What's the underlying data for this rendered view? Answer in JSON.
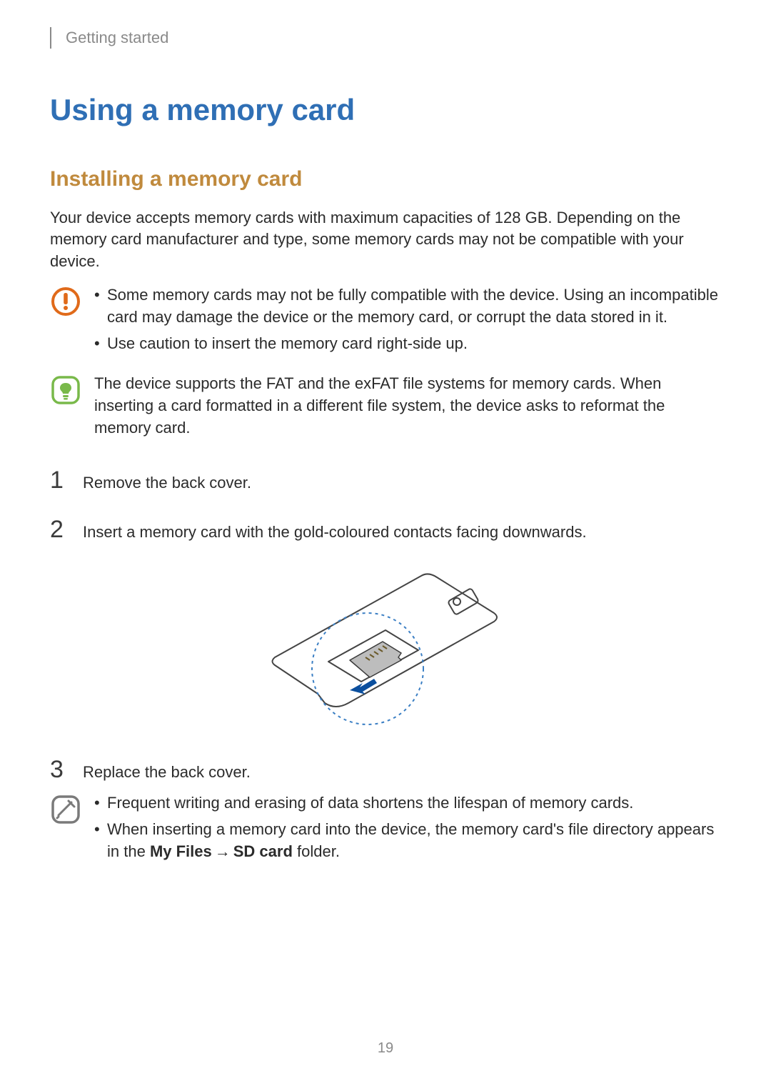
{
  "header": {
    "breadcrumb": "Getting started"
  },
  "title": "Using a memory card",
  "sections": {
    "install": {
      "heading": "Installing a memory card",
      "intro": "Your device accepts memory cards with maximum capacities of 128 GB. Depending on the memory card manufacturer and type, some memory cards may not be compatible with your device.",
      "caution": {
        "items": [
          "Some memory cards may not be fully compatible with the device. Using an incompatible card may damage the device or the memory card, or corrupt the data stored in it.",
          "Use caution to insert the memory card right-side up."
        ]
      },
      "info": {
        "text": "The device supports the FAT and the exFAT file systems for memory cards. When inserting a card formatted in a different file system, the device asks to reformat the memory card."
      },
      "steps": [
        {
          "n": "1",
          "text": "Remove the back cover."
        },
        {
          "n": "2",
          "text": "Insert a memory card with the gold-coloured contacts facing downwards."
        },
        {
          "n": "3",
          "text": "Replace the back cover."
        }
      ],
      "tips": {
        "items": [
          "Frequent writing and erasing of data shortens the lifespan of memory cards."
        ],
        "item2_pre": "When inserting a memory card into the device, the memory card's file directory appears in the ",
        "item2_bold1": "My Files",
        "item2_arrow": "→",
        "item2_bold2": "SD card",
        "item2_post": " folder."
      }
    }
  },
  "page_number": "19",
  "icons": {
    "caution": "caution-icon",
    "info": "note-icon",
    "tip": "tip-icon"
  }
}
